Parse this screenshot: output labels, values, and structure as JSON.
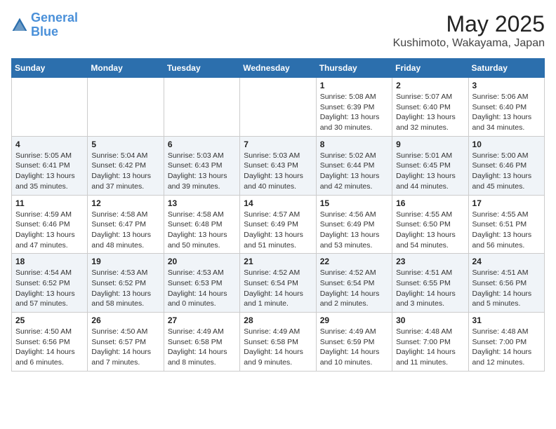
{
  "header": {
    "logo_line1": "General",
    "logo_line2": "Blue",
    "title": "May 2025",
    "subtitle": "Kushimoto, Wakayama, Japan"
  },
  "days_of_week": [
    "Sunday",
    "Monday",
    "Tuesday",
    "Wednesday",
    "Thursday",
    "Friday",
    "Saturday"
  ],
  "weeks": [
    [
      {
        "day": "",
        "info": ""
      },
      {
        "day": "",
        "info": ""
      },
      {
        "day": "",
        "info": ""
      },
      {
        "day": "",
        "info": ""
      },
      {
        "day": "1",
        "info": "Sunrise: 5:08 AM\nSunset: 6:39 PM\nDaylight: 13 hours\nand 30 minutes."
      },
      {
        "day": "2",
        "info": "Sunrise: 5:07 AM\nSunset: 6:40 PM\nDaylight: 13 hours\nand 32 minutes."
      },
      {
        "day": "3",
        "info": "Sunrise: 5:06 AM\nSunset: 6:40 PM\nDaylight: 13 hours\nand 34 minutes."
      }
    ],
    [
      {
        "day": "4",
        "info": "Sunrise: 5:05 AM\nSunset: 6:41 PM\nDaylight: 13 hours\nand 35 minutes."
      },
      {
        "day": "5",
        "info": "Sunrise: 5:04 AM\nSunset: 6:42 PM\nDaylight: 13 hours\nand 37 minutes."
      },
      {
        "day": "6",
        "info": "Sunrise: 5:03 AM\nSunset: 6:43 PM\nDaylight: 13 hours\nand 39 minutes."
      },
      {
        "day": "7",
        "info": "Sunrise: 5:03 AM\nSunset: 6:43 PM\nDaylight: 13 hours\nand 40 minutes."
      },
      {
        "day": "8",
        "info": "Sunrise: 5:02 AM\nSunset: 6:44 PM\nDaylight: 13 hours\nand 42 minutes."
      },
      {
        "day": "9",
        "info": "Sunrise: 5:01 AM\nSunset: 6:45 PM\nDaylight: 13 hours\nand 44 minutes."
      },
      {
        "day": "10",
        "info": "Sunrise: 5:00 AM\nSunset: 6:46 PM\nDaylight: 13 hours\nand 45 minutes."
      }
    ],
    [
      {
        "day": "11",
        "info": "Sunrise: 4:59 AM\nSunset: 6:46 PM\nDaylight: 13 hours\nand 47 minutes."
      },
      {
        "day": "12",
        "info": "Sunrise: 4:58 AM\nSunset: 6:47 PM\nDaylight: 13 hours\nand 48 minutes."
      },
      {
        "day": "13",
        "info": "Sunrise: 4:58 AM\nSunset: 6:48 PM\nDaylight: 13 hours\nand 50 minutes."
      },
      {
        "day": "14",
        "info": "Sunrise: 4:57 AM\nSunset: 6:49 PM\nDaylight: 13 hours\nand 51 minutes."
      },
      {
        "day": "15",
        "info": "Sunrise: 4:56 AM\nSunset: 6:49 PM\nDaylight: 13 hours\nand 53 minutes."
      },
      {
        "day": "16",
        "info": "Sunrise: 4:55 AM\nSunset: 6:50 PM\nDaylight: 13 hours\nand 54 minutes."
      },
      {
        "day": "17",
        "info": "Sunrise: 4:55 AM\nSunset: 6:51 PM\nDaylight: 13 hours\nand 56 minutes."
      }
    ],
    [
      {
        "day": "18",
        "info": "Sunrise: 4:54 AM\nSunset: 6:52 PM\nDaylight: 13 hours\nand 57 minutes."
      },
      {
        "day": "19",
        "info": "Sunrise: 4:53 AM\nSunset: 6:52 PM\nDaylight: 13 hours\nand 58 minutes."
      },
      {
        "day": "20",
        "info": "Sunrise: 4:53 AM\nSunset: 6:53 PM\nDaylight: 14 hours\nand 0 minutes."
      },
      {
        "day": "21",
        "info": "Sunrise: 4:52 AM\nSunset: 6:54 PM\nDaylight: 14 hours\nand 1 minute."
      },
      {
        "day": "22",
        "info": "Sunrise: 4:52 AM\nSunset: 6:54 PM\nDaylight: 14 hours\nand 2 minutes."
      },
      {
        "day": "23",
        "info": "Sunrise: 4:51 AM\nSunset: 6:55 PM\nDaylight: 14 hours\nand 3 minutes."
      },
      {
        "day": "24",
        "info": "Sunrise: 4:51 AM\nSunset: 6:56 PM\nDaylight: 14 hours\nand 5 minutes."
      }
    ],
    [
      {
        "day": "25",
        "info": "Sunrise: 4:50 AM\nSunset: 6:56 PM\nDaylight: 14 hours\nand 6 minutes."
      },
      {
        "day": "26",
        "info": "Sunrise: 4:50 AM\nSunset: 6:57 PM\nDaylight: 14 hours\nand 7 minutes."
      },
      {
        "day": "27",
        "info": "Sunrise: 4:49 AM\nSunset: 6:58 PM\nDaylight: 14 hours\nand 8 minutes."
      },
      {
        "day": "28",
        "info": "Sunrise: 4:49 AM\nSunset: 6:58 PM\nDaylight: 14 hours\nand 9 minutes."
      },
      {
        "day": "29",
        "info": "Sunrise: 4:49 AM\nSunset: 6:59 PM\nDaylight: 14 hours\nand 10 minutes."
      },
      {
        "day": "30",
        "info": "Sunrise: 4:48 AM\nSunset: 7:00 PM\nDaylight: 14 hours\nand 11 minutes."
      },
      {
        "day": "31",
        "info": "Sunrise: 4:48 AM\nSunset: 7:00 PM\nDaylight: 14 hours\nand 12 minutes."
      }
    ]
  ]
}
